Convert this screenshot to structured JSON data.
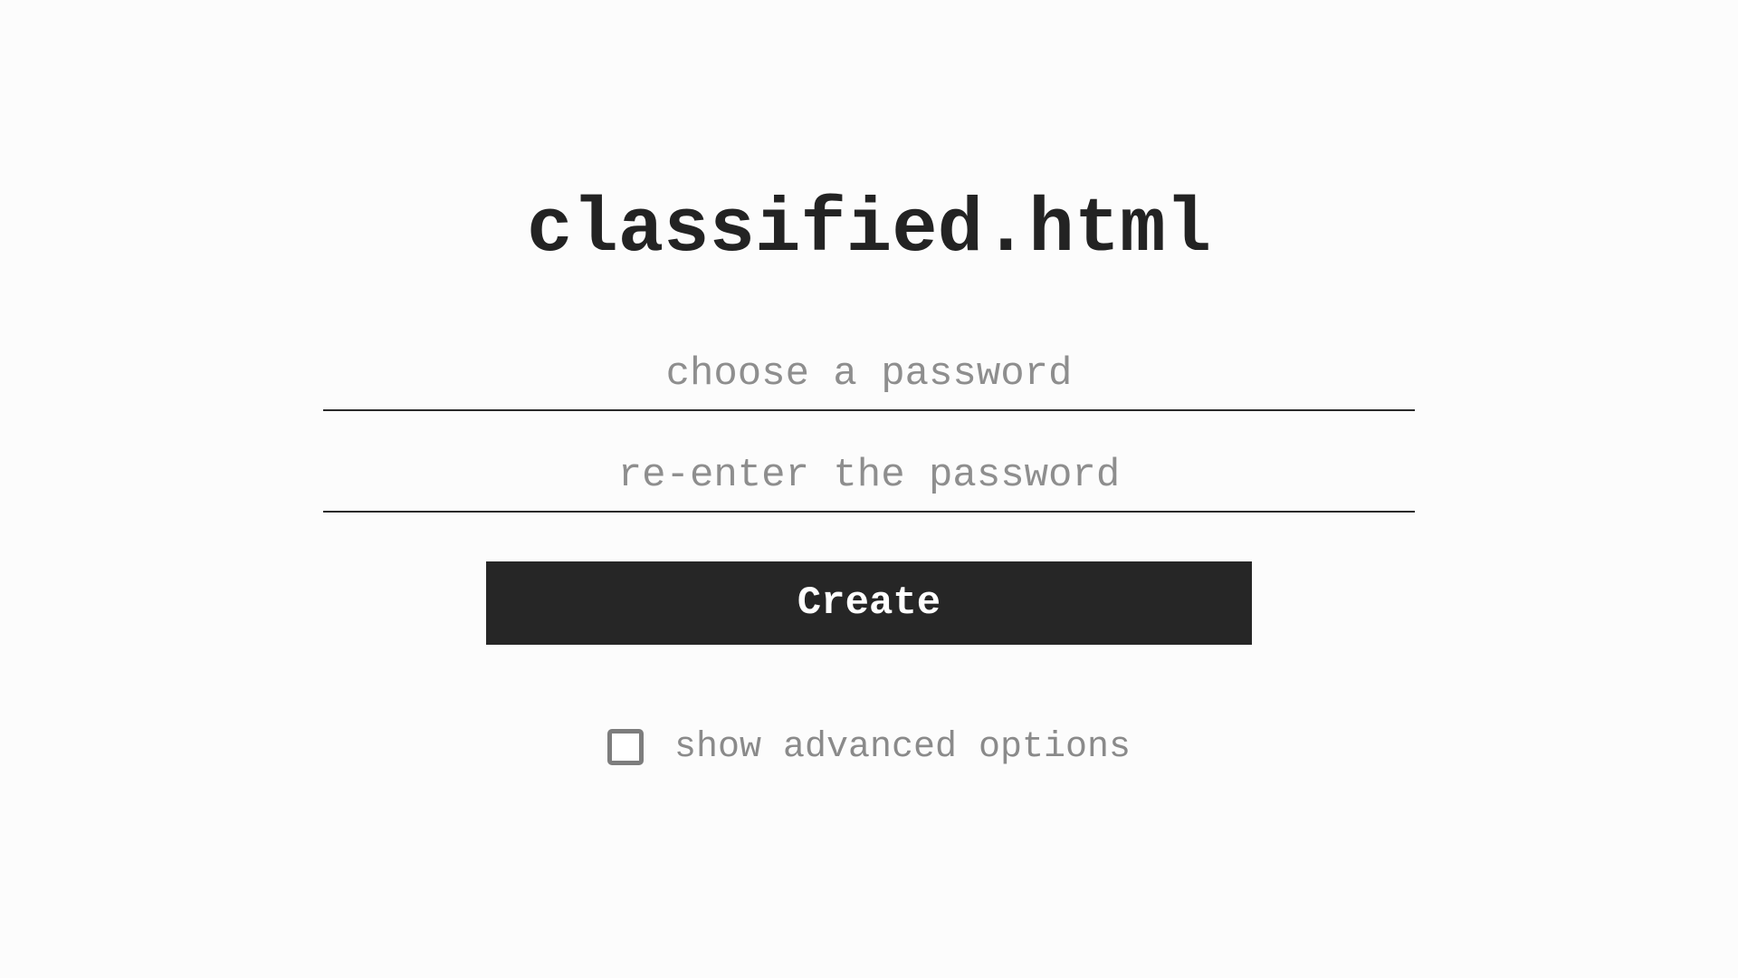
{
  "header": {
    "title": "classified.html"
  },
  "form": {
    "password_placeholder": "choose a password",
    "password_value": "",
    "confirm_placeholder": "re-enter the password",
    "confirm_value": "",
    "create_label": "Create",
    "advanced_label": "show advanced options",
    "advanced_checked": false
  },
  "colors": {
    "background": "#fcfcfc",
    "text": "#232323",
    "button_bg": "#262626",
    "placeholder": "#8e8e8e"
  }
}
